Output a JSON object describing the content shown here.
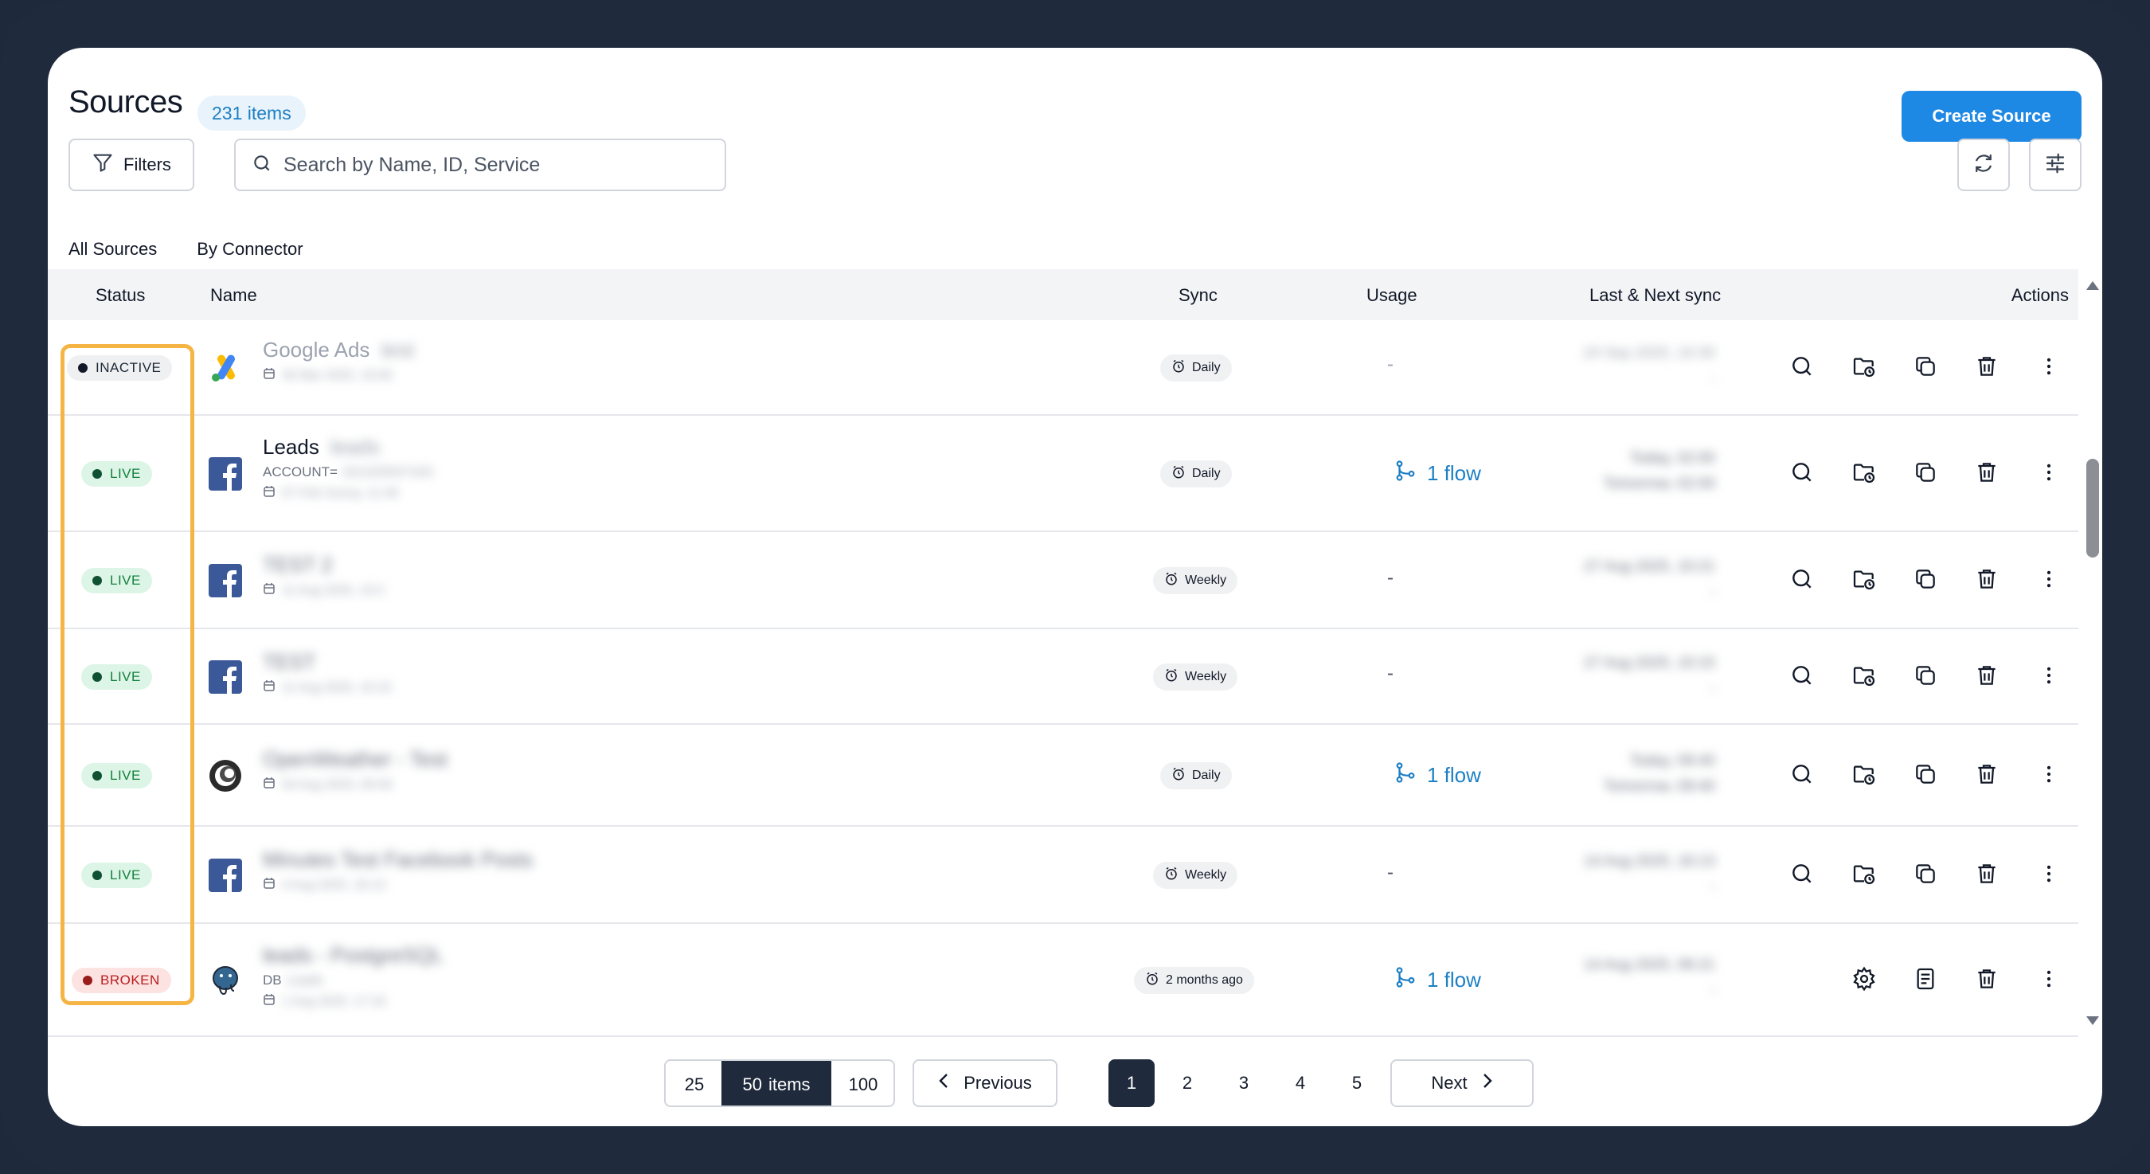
{
  "header": {
    "title": "Sources",
    "count": "231 items",
    "create_label": "Create Source"
  },
  "toolbar": {
    "filters_label": "Filters",
    "search_placeholder": "Search by Name, ID, Service"
  },
  "tabs": [
    {
      "label": "All Sources",
      "active": true
    },
    {
      "label": "By Connector",
      "active": false
    }
  ],
  "columns": {
    "status": "Status",
    "name": "Name",
    "sync": "Sync",
    "usage": "Usage",
    "last_next": "Last & Next sync",
    "actions": "Actions"
  },
  "rows": [
    {
      "status": "INACTIVE",
      "service_icon": "google-ads-icon",
      "name": "Google Ads",
      "name_extra": "test",
      "sub": "",
      "sub_extra": "",
      "date": "30 Mar 2025, 10:00",
      "sync": "Daily",
      "usage": "-",
      "last": "24 Sep 2025, 10:30",
      "next": "-"
    },
    {
      "status": "LIVE",
      "service_icon": "facebook-icon",
      "name": "Leads",
      "name_extra": "leads",
      "sub": "ACCOUNT=",
      "sub_extra": "321203537163",
      "date": "07 Feb Sunny, 11:46",
      "sync": "Daily",
      "usage": "1 flow",
      "last": "Today, 02:00",
      "next": "Tomorrow, 02:00"
    },
    {
      "status": "LIVE",
      "service_icon": "facebook-icon",
      "name": "TEST 2",
      "name_extra": "",
      "sub": "",
      "sub_extra": "",
      "date": "11 Aug 2025, 10:2",
      "sync": "Weekly",
      "usage": "-",
      "last": "27 Aug 2025, 10:21",
      "next": "-"
    },
    {
      "status": "LIVE",
      "service_icon": "facebook-icon",
      "name": "TEST",
      "name_extra": "",
      "sub": "",
      "sub_extra": "",
      "date": "11 Aug 2025, 10:15",
      "sync": "Weekly",
      "usage": "-",
      "last": "27 Aug 2025, 10:15",
      "next": "-"
    },
    {
      "status": "LIVE",
      "service_icon": "openweather-icon",
      "name": "OpenWeather - Test",
      "name_extra": "",
      "sub": "",
      "sub_extra": "",
      "date": "04 Aug 2025, 09:40",
      "sync": "Daily",
      "usage": "1 flow",
      "last": "Today, 09:40",
      "next": "Tomorrow, 09:40"
    },
    {
      "status": "LIVE",
      "service_icon": "facebook-icon",
      "name": "Minutes Test Facebook Posts",
      "name_extra": "",
      "sub": "",
      "sub_extra": "",
      "date": "4 Aug 2025, 16:13",
      "sync": "Weekly",
      "usage": "-",
      "last": "14 Aug 2025, 16:13",
      "next": "-"
    },
    {
      "status": "BROKEN",
      "service_icon": "postgresql-icon",
      "name": "leads - PostgreSQL",
      "name_extra": "",
      "sub": "DB",
      "sub_extra": "Leads",
      "date": "1 Aug 2025, 17:18",
      "sync": "2 months ago",
      "usage": "1 flow",
      "last": "14 Aug 2025, 06:21",
      "next": "-"
    }
  ],
  "pagination": {
    "sizes": [
      "25",
      "50",
      "100"
    ],
    "items_label": "items",
    "previous": "Previous",
    "next": "Next",
    "pages": [
      "1",
      "2",
      "3",
      "4",
      "5"
    ],
    "current_page": "1"
  },
  "colors": {
    "accent": "#1e88e5",
    "live": "#15803d",
    "broken": "#b91c1c",
    "highlight": "#f5b544",
    "frame": "#1f2a3c"
  }
}
